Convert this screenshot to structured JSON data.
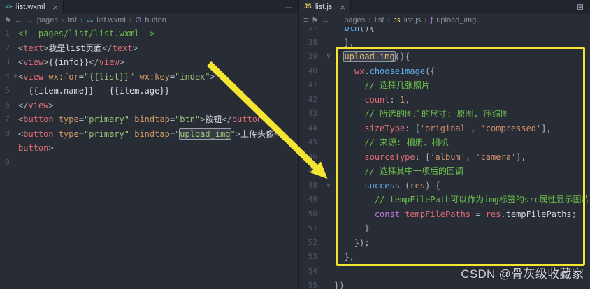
{
  "colors": {
    "bg": "#282c34",
    "tabbar": "#21252b",
    "border": "#181a1f",
    "text": "#abb2bf",
    "white": "#d7dae0",
    "gutter": "#4e5666",
    "comment": "#6cbf4d",
    "tag": "#e06c75",
    "attr": "#d19a66",
    "string_green": "#98c379",
    "string_orange": "#cf8e6d",
    "func_yellow": "#e5c07b",
    "blue": "#61afef",
    "purple": "#c678dd",
    "red": "#e06c75",
    "orange": "#d19a66",
    "punct": "#abb2bf",
    "highlight": "#f4e532",
    "watermark": "#cfd2d6"
  },
  "icons": {
    "close": "×",
    "more": "···",
    "split": "⊞",
    "menu": "≡",
    "bookmark": "⚑",
    "back": "←",
    "forward": "→",
    "crumb_sep": "›",
    "fold": "∨",
    "symbol_button": "∅",
    "symbol_method": "ƒ",
    "wxml_file": "<>",
    "js_file": "JS"
  },
  "left_pane": {
    "tab": {
      "label": "list.wxml"
    },
    "breadcrumb": {
      "items": [
        "pages",
        "list",
        "list.wxml",
        "button"
      ]
    },
    "code": {
      "lines": [
        {
          "n": "1",
          "tokens": [
            [
              "<!--pages/list/list.wxml-->",
              "comment"
            ]
          ]
        },
        {
          "n": "2",
          "tokens": [
            [
              "<",
              "punct"
            ],
            [
              "text",
              "tag"
            ],
            [
              ">",
              "punct"
            ],
            [
              "我是list页面",
              "white"
            ],
            [
              "</",
              "punct"
            ],
            [
              "text",
              "tag"
            ],
            [
              ">",
              "punct"
            ]
          ]
        },
        {
          "n": "3",
          "tokens": [
            [
              "<",
              "punct"
            ],
            [
              "view",
              "tag"
            ],
            [
              ">",
              "punct"
            ],
            [
              "{{info}}",
              "white"
            ],
            [
              "</",
              "punct"
            ],
            [
              "view",
              "tag"
            ],
            [
              ">",
              "punct"
            ]
          ]
        },
        {
          "n": "4",
          "fold": true,
          "tokens": [
            [
              "<",
              "punct"
            ],
            [
              "view",
              "tag"
            ],
            [
              " ",
              "punct"
            ],
            [
              "wx:for",
              "attr"
            ],
            [
              "=",
              "punct"
            ],
            [
              "\"{{list}}\"",
              "string_green"
            ],
            [
              " ",
              "punct"
            ],
            [
              "wx:key",
              "attr"
            ],
            [
              "=",
              "punct"
            ],
            [
              "\"index\"",
              "string_green"
            ],
            [
              ">",
              "punct"
            ]
          ]
        },
        {
          "n": "5",
          "ind": 1,
          "tokens": [
            [
              "{{item.name}}---{{item.age}}",
              "white"
            ]
          ]
        },
        {
          "n": "6",
          "tokens": [
            [
              "</",
              "punct"
            ],
            [
              "view",
              "tag"
            ],
            [
              ">",
              "punct"
            ]
          ]
        },
        {
          "n": "7",
          "tokens": [
            [
              "<",
              "punct"
            ],
            [
              "button",
              "tag"
            ],
            [
              " ",
              "punct"
            ],
            [
              "type",
              "attr"
            ],
            [
              "=",
              "punct"
            ],
            [
              "\"primary\"",
              "string_green"
            ],
            [
              " ",
              "punct"
            ],
            [
              "bindtap",
              "attr"
            ],
            [
              "=",
              "punct"
            ],
            [
              "\"btn\"",
              "string_green"
            ],
            [
              ">",
              "punct"
            ],
            [
              "按钮",
              "white"
            ],
            [
              "</",
              "punct"
            ],
            [
              "button",
              "tag"
            ],
            [
              ">",
              "punct"
            ]
          ]
        },
        {
          "n": "8",
          "tokens": [
            [
              "<",
              "punct"
            ],
            [
              "button",
              "tag"
            ],
            [
              " ",
              "punct"
            ],
            [
              "type",
              "attr"
            ],
            [
              "=",
              "punct"
            ],
            [
              "\"primary\"",
              "string_green"
            ],
            [
              " ",
              "punct"
            ],
            [
              "bindtap",
              "attr"
            ],
            [
              "=",
              "punct"
            ],
            [
              "\"",
              "string_green"
            ],
            [
              "upload_img",
              "string_green",
              "boxed"
            ],
            [
              "\"",
              "string_green"
            ],
            [
              ">",
              "punct"
            ],
            [
              "上传头像",
              "white"
            ],
            [
              "</",
              "punct"
            ]
          ]
        },
        {
          "n": "",
          "tokens": [
            [
              "button",
              "tag"
            ],
            [
              ">",
              "punct"
            ]
          ]
        },
        {
          "n": "9",
          "tokens": []
        }
      ]
    }
  },
  "right_pane": {
    "tab": {
      "label": "list.js"
    },
    "breadcrumb": {
      "items": [
        "pages",
        "list",
        "list.js",
        "upload_img"
      ]
    },
    "code": {
      "lines": [
        {
          "n": "37",
          "ind": 1,
          "tokens": [
            [
              "btn",
              "blue"
            ],
            [
              "(){",
              "punct"
            ]
          ]
        },
        {
          "n": "38",
          "ind": 1,
          "tokens": [
            [
              "},",
              "punct"
            ]
          ]
        },
        {
          "n": "39",
          "ind": 1,
          "fold": true,
          "tokens": [
            [
              "upload_img",
              "func_yellow",
              "boxed2"
            ],
            [
              "(){",
              "punct"
            ]
          ]
        },
        {
          "n": "40",
          "ind": 2,
          "tokens": [
            [
              "wx",
              "red"
            ],
            [
              ".",
              "punct"
            ],
            [
              "chooseImage",
              "blue"
            ],
            [
              "({",
              "punct"
            ]
          ]
        },
        {
          "n": "41",
          "ind": 3,
          "tokens": [
            [
              "// 选择几张照片",
              "comment"
            ]
          ]
        },
        {
          "n": "42",
          "ind": 3,
          "tokens": [
            [
              "count",
              "red"
            ],
            [
              ": ",
              "punct"
            ],
            [
              "1",
              "orange"
            ],
            [
              ",",
              "punct"
            ]
          ]
        },
        {
          "n": "43",
          "ind": 3,
          "tokens": [
            [
              "// 所选的图片的尺寸: 原图, 压缩图",
              "comment"
            ]
          ]
        },
        {
          "n": "44",
          "ind": 3,
          "tokens": [
            [
              "sizeType",
              "red"
            ],
            [
              ": [",
              "punct"
            ],
            [
              "'original'",
              "string_orange"
            ],
            [
              ", ",
              "punct"
            ],
            [
              "'compressed'",
              "string_orange"
            ],
            [
              "],",
              "punct"
            ]
          ]
        },
        {
          "n": "45",
          "ind": 3,
          "tokens": [
            [
              "// 来源: 相册、相机",
              "comment"
            ]
          ]
        },
        {
          "n": "46",
          "ind": 3,
          "tokens": [
            [
              "sourceType",
              "red"
            ],
            [
              ": [",
              "punct"
            ],
            [
              "'album'",
              "string_orange"
            ],
            [
              ", ",
              "punct"
            ],
            [
              "'camera'",
              "string_orange"
            ],
            [
              "],",
              "punct"
            ]
          ]
        },
        {
          "n": "47",
          "ind": 3,
          "tokens": [
            [
              "// 选择其中一项后的回调",
              "comment"
            ]
          ]
        },
        {
          "n": "48",
          "ind": 3,
          "fold": true,
          "tokens": [
            [
              "success",
              "blue"
            ],
            [
              " (",
              "punct"
            ],
            [
              "res",
              "orange"
            ],
            [
              ") {",
              "punct"
            ]
          ]
        },
        {
          "n": "49",
          "ind": 4,
          "tokens": [
            [
              "// tempFilePath可以作为img标签的src属性显示图片",
              "comment"
            ]
          ]
        },
        {
          "n": "50",
          "ind": 4,
          "tokens": [
            [
              "const",
              "purple"
            ],
            [
              " ",
              "punct"
            ],
            [
              "tempFilePaths",
              "red"
            ],
            [
              " = ",
              "punct"
            ],
            [
              "res",
              "red"
            ],
            [
              ".",
              "punct"
            ],
            [
              "tempFilePaths",
              "white"
            ],
            [
              ";",
              "punct"
            ]
          ]
        },
        {
          "n": "51",
          "ind": 3,
          "tokens": [
            [
              "}",
              "punct"
            ]
          ]
        },
        {
          "n": "52",
          "ind": 2,
          "tokens": [
            [
              "});",
              "punct"
            ]
          ]
        },
        {
          "n": "53",
          "ind": 1,
          "tokens": [
            [
              "},",
              "punct"
            ]
          ]
        },
        {
          "n": "54",
          "ind": 0,
          "tokens": []
        },
        {
          "n": "55",
          "ind": 0,
          "tokens": [
            [
              "})",
              "punct"
            ]
          ]
        }
      ]
    }
  },
  "watermark": {
    "text": "CSDN @骨灰级收藏家"
  }
}
